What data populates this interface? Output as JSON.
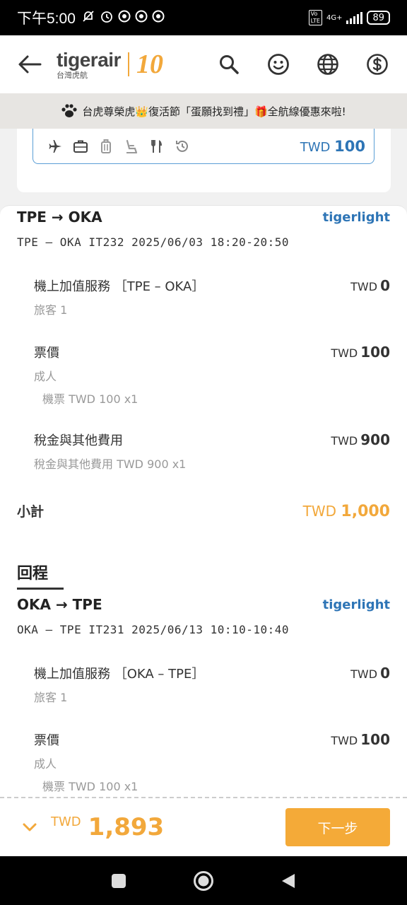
{
  "status": {
    "time": "下午5:00",
    "network": "4G+",
    "battery": "89"
  },
  "header": {
    "logo_main_a": "tiger",
    "logo_main_b": "air",
    "logo_sub": "台灣虎航",
    "logo_anniv": "10"
  },
  "banner": {
    "text": "台虎尊榮虎👑復活節「蛋願找到禮」🎁全航線優惠來啦!"
  },
  "service_summary": {
    "currency": "TWD",
    "amount": "100"
  },
  "outbound": {
    "route": "TPE → OKA",
    "fare_type": "tigerlight",
    "flight_info": "TPE – OKA  IT232 2025/06/03 18:20-20:50",
    "items": [
      {
        "title": "機上加值服務 ［TPE – OKA］",
        "currency": "TWD",
        "amount": "0",
        "sub": "旅客 1",
        "sub2": ""
      },
      {
        "title": "票價",
        "currency": "TWD",
        "amount": "100",
        "sub": "成人",
        "sub2": "機票 TWD 100 x1"
      },
      {
        "title": "稅金與其他費用",
        "currency": "TWD",
        "amount": "900",
        "sub": "稅金與其他費用 TWD 900 x1",
        "sub2": ""
      }
    ],
    "subtotal_label": "小計",
    "subtotal_currency": "TWD",
    "subtotal_amount": "1,000"
  },
  "return": {
    "section_title": "回程",
    "route": "OKA → TPE",
    "fare_type": "tigerlight",
    "flight_info": "OKA – TPE  IT231 2025/06/13 10:10-10:40",
    "items": [
      {
        "title": "機上加值服務 ［OKA – TPE］",
        "currency": "TWD",
        "amount": "0",
        "sub": "旅客 1",
        "sub2": ""
      },
      {
        "title": "票價",
        "currency": "TWD",
        "amount": "100",
        "sub": "成人",
        "sub2": "機票 TWD 100 x1"
      }
    ]
  },
  "footer": {
    "total_currency": "TWD",
    "total_amount": "1,893",
    "next_label": "下一步"
  },
  "colors": {
    "accent": "#f2a83b",
    "link_blue": "#2e75b6"
  }
}
